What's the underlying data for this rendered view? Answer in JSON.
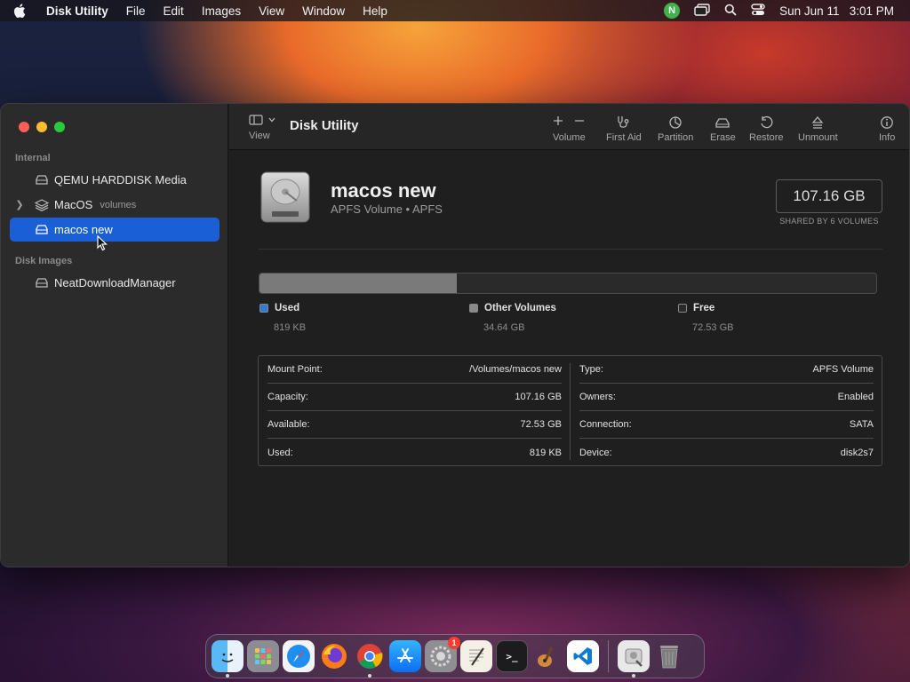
{
  "menubar": {
    "app_name": "Disk Utility",
    "items": [
      "File",
      "Edit",
      "Images",
      "View",
      "Window",
      "Help"
    ],
    "status_badge": "N",
    "clock": "Sun Jun 11   3:01 PM"
  },
  "sidebar": {
    "section_internal": "Internal",
    "section_images": "Disk Images",
    "items": [
      {
        "label": "QEMU HARDDISK Media",
        "sub": ""
      },
      {
        "label": "MacOS",
        "sub": "volumes"
      },
      {
        "label": "macos new",
        "sub": ""
      },
      {
        "label": "NeatDownloadManager",
        "sub": ""
      }
    ]
  },
  "toolbar": {
    "view_label": "View",
    "title": "Disk Utility",
    "buttons": {
      "volume": "Volume",
      "first_aid": "First Aid",
      "partition": "Partition",
      "erase": "Erase",
      "restore": "Restore",
      "unmount": "Unmount",
      "info": "Info"
    }
  },
  "volume": {
    "name": "macos new",
    "subtitle": "APFS Volume • APFS",
    "size": "107.16 GB",
    "size_caption": "SHARED BY 6 VOLUMES"
  },
  "usage": {
    "used_fraction": 0.32,
    "used_color": "#7a7a7a",
    "legend": [
      {
        "label": "Used",
        "value": "819 KB",
        "color": "#2f7bd6"
      },
      {
        "label": "Other Volumes",
        "value": "34.64 GB",
        "color": "#8a8a8a"
      },
      {
        "label": "Free",
        "value": "72.53 GB",
        "color": "#2a2a2a"
      }
    ]
  },
  "info": {
    "left": [
      {
        "key": "Mount Point:",
        "value": "/Volumes/macos new"
      },
      {
        "key": "Capacity:",
        "value": "107.16 GB"
      },
      {
        "key": "Available:",
        "value": "72.53 GB"
      },
      {
        "key": "Used:",
        "value": "819 KB"
      }
    ],
    "right": [
      {
        "key": "Type:",
        "value": "APFS Volume"
      },
      {
        "key": "Owners:",
        "value": "Enabled"
      },
      {
        "key": "Connection:",
        "value": "SATA"
      },
      {
        "key": "Device:",
        "value": "disk2s7"
      }
    ]
  },
  "dock": {
    "settings_badge": "1",
    "app_icons": [
      "finder-icon",
      "launchpad-icon",
      "safari-icon",
      "firefox-icon",
      "chrome-icon",
      "app-store-icon",
      "system-settings-icon",
      "textedit-icon",
      "terminal-icon",
      "garageband-icon",
      "vscode-icon",
      "disk-utility-icon",
      "trash-icon"
    ]
  }
}
